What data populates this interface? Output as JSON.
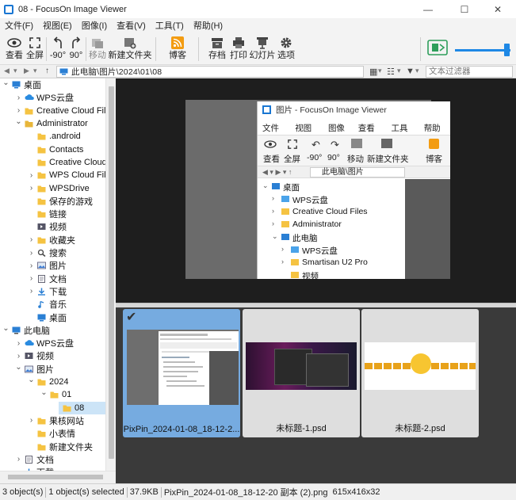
{
  "window": {
    "title": "08 - FocusOn Image Viewer",
    "controls": {
      "minimize": "—",
      "maximize": "☐",
      "close": "✕"
    }
  },
  "menu": [
    "文件(F)",
    "视图(E)",
    "图像(I)",
    "查看(V)",
    "工具(T)",
    "帮助(H)"
  ],
  "toolbar": {
    "view": "查看",
    "fullscreen": "全屏",
    "rotate_left": "-90°",
    "rotate_right": "90°",
    "move": "移动",
    "new_folder": "新建文件夹",
    "blog": "博客",
    "save": "存档",
    "print": "打印",
    "slideshow": "幻灯片",
    "options": "选项"
  },
  "address": {
    "path": "此电脑\\图片\\2024\\01\\08",
    "search_placeholder": "文本过滤器"
  },
  "tree": [
    {
      "label": "桌面",
      "icon": "desktop-icon",
      "chev": "down"
    },
    {
      "label": "WPS云盘",
      "icon": "cloud-icon",
      "chev": "right"
    },
    {
      "label": "Creative Cloud File",
      "icon": "folder-icon",
      "chev": "right"
    },
    {
      "label": "Administrator",
      "icon": "user-icon",
      "chev": "down"
    },
    {
      "label": ".android",
      "icon": "folder-icon",
      "chev": ""
    },
    {
      "label": "Contacts",
      "icon": "folder-icon",
      "chev": ""
    },
    {
      "label": "Creative Cloud",
      "icon": "folder-icon",
      "chev": ""
    },
    {
      "label": "WPS Cloud File",
      "icon": "folder-icon",
      "chev": "right"
    },
    {
      "label": "WPSDrive",
      "icon": "folder-icon",
      "chev": "right"
    },
    {
      "label": "保存的游戏",
      "icon": "folder-icon",
      "chev": ""
    },
    {
      "label": "链接",
      "icon": "folder-icon",
      "chev": ""
    },
    {
      "label": "视频",
      "icon": "video-icon",
      "chev": ""
    },
    {
      "label": "收藏夹",
      "icon": "folder-icon",
      "chev": "right"
    },
    {
      "label": "搜索",
      "icon": "search-icon",
      "chev": "right"
    },
    {
      "label": "图片",
      "icon": "picture-icon",
      "chev": "right"
    },
    {
      "label": "文档",
      "icon": "document-icon",
      "chev": "right"
    },
    {
      "label": "下载",
      "icon": "download-icon",
      "chev": "right"
    },
    {
      "label": "音乐",
      "icon": "music-icon",
      "chev": ""
    },
    {
      "label": "桌面",
      "icon": "desktop-icon",
      "chev": ""
    },
    {
      "label": "此电脑",
      "icon": "computer-icon",
      "chev": "down"
    },
    {
      "label": "WPS云盘",
      "icon": "cloud-icon",
      "chev": "right"
    },
    {
      "label": "视频",
      "icon": "video-icon",
      "chev": "right"
    },
    {
      "label": "图片",
      "icon": "picture-icon",
      "chev": "down"
    },
    {
      "label": "2024",
      "icon": "folder-icon",
      "chev": "down"
    },
    {
      "label": "01",
      "icon": "folder-icon",
      "chev": "down"
    },
    {
      "label": "08",
      "icon": "folder-icon",
      "chev": "",
      "selected": true
    },
    {
      "label": "果核网站",
      "icon": "folder-icon",
      "chev": "right"
    },
    {
      "label": "小表情",
      "icon": "folder-icon",
      "chev": ""
    },
    {
      "label": "新建文件夹",
      "icon": "folder-icon",
      "chev": ""
    },
    {
      "label": "文档",
      "icon": "document-icon",
      "chev": "right"
    },
    {
      "label": "下载",
      "icon": "download-icon",
      "chev": "right"
    }
  ],
  "preview_inner": {
    "title": "图片 - FocusOn Image Viewer",
    "menu": [
      "文件(F)",
      "视图(E)",
      "图像(I)",
      "查看(V)",
      "工具(T)",
      "帮助(H)"
    ],
    "toolbar": [
      "查看",
      "全屏",
      "-90°",
      "90°",
      "移动",
      "新建文件夹",
      "博客"
    ],
    "path": "此电脑\\图片",
    "tree": [
      {
        "label": "桌面",
        "chev": "down"
      },
      {
        "label": "WPS云盘",
        "chev": "right"
      },
      {
        "label": "Creative Cloud Files",
        "chev": "right"
      },
      {
        "label": "Administrator",
        "chev": "right"
      },
      {
        "label": "此电脑",
        "chev": "down"
      },
      {
        "label": "WPS云盘",
        "chev": "right"
      },
      {
        "label": "Smartisan U2 Pro",
        "chev": "right"
      },
      {
        "label": "视频",
        "chev": ""
      }
    ]
  },
  "thumbnails": [
    {
      "caption": "PixPin_2024-01-08_18-12-2...",
      "selected": true,
      "checkmark": "✔"
    },
    {
      "caption": "未标题-1.psd",
      "selected": false
    },
    {
      "caption": "未标题-2.psd",
      "selected": false
    }
  ],
  "status": {
    "objects": "3 object(s)",
    "selected": "1 object(s) selected",
    "size": "37.9KB",
    "filename": "PixPin_2024-01-08_18-12-20 副本 (2).png",
    "dimensions": "615x416x32"
  },
  "colors": {
    "accent": "#1e88e5",
    "selected_card": "#76abe0",
    "tree_selected": "#cce4f7",
    "folder": "#f5c342",
    "dark_bg": "#1e1e1e"
  }
}
